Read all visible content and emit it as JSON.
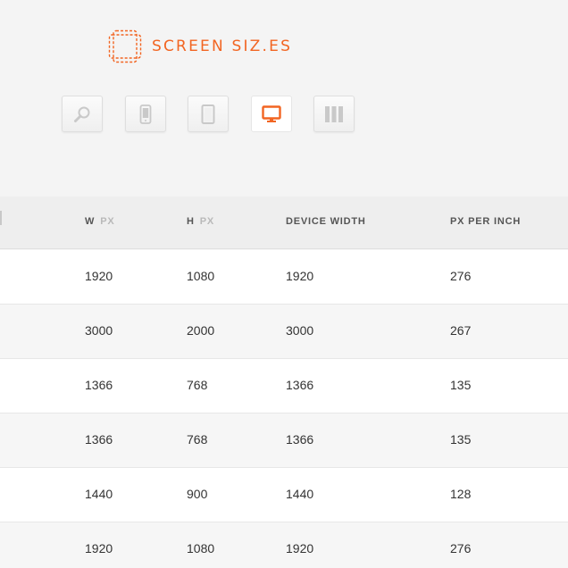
{
  "header": {
    "logo_text": "SCREEN SIZ.ES",
    "brand_color": "#f26522"
  },
  "toolbar": {
    "buttons": [
      {
        "icon": "search-icon",
        "active": false
      },
      {
        "icon": "phone-icon",
        "active": false
      },
      {
        "icon": "tablet-icon",
        "active": false
      },
      {
        "icon": "desktop-icon",
        "active": true
      },
      {
        "icon": "columns-icon",
        "active": false
      }
    ]
  },
  "table": {
    "headers": {
      "w": "W",
      "w_unit": "PX",
      "h": "H",
      "h_unit": "PX",
      "device_width": "DEVICE WIDTH",
      "ppi": "PX PER INCH"
    },
    "rows": [
      {
        "w": "1920",
        "h": "1080",
        "device_width": "1920",
        "ppi": "276"
      },
      {
        "w": "3000",
        "h": "2000",
        "device_width": "3000",
        "ppi": "267"
      },
      {
        "w": "1366",
        "h": "768",
        "device_width": "1366",
        "ppi": "135"
      },
      {
        "w": "1366",
        "h": "768",
        "device_width": "1366",
        "ppi": "135"
      },
      {
        "w": "1440",
        "h": "900",
        "device_width": "1440",
        "ppi": "128"
      },
      {
        "w": "1920",
        "h": "1080",
        "device_width": "1920",
        "ppi": "276"
      }
    ]
  }
}
